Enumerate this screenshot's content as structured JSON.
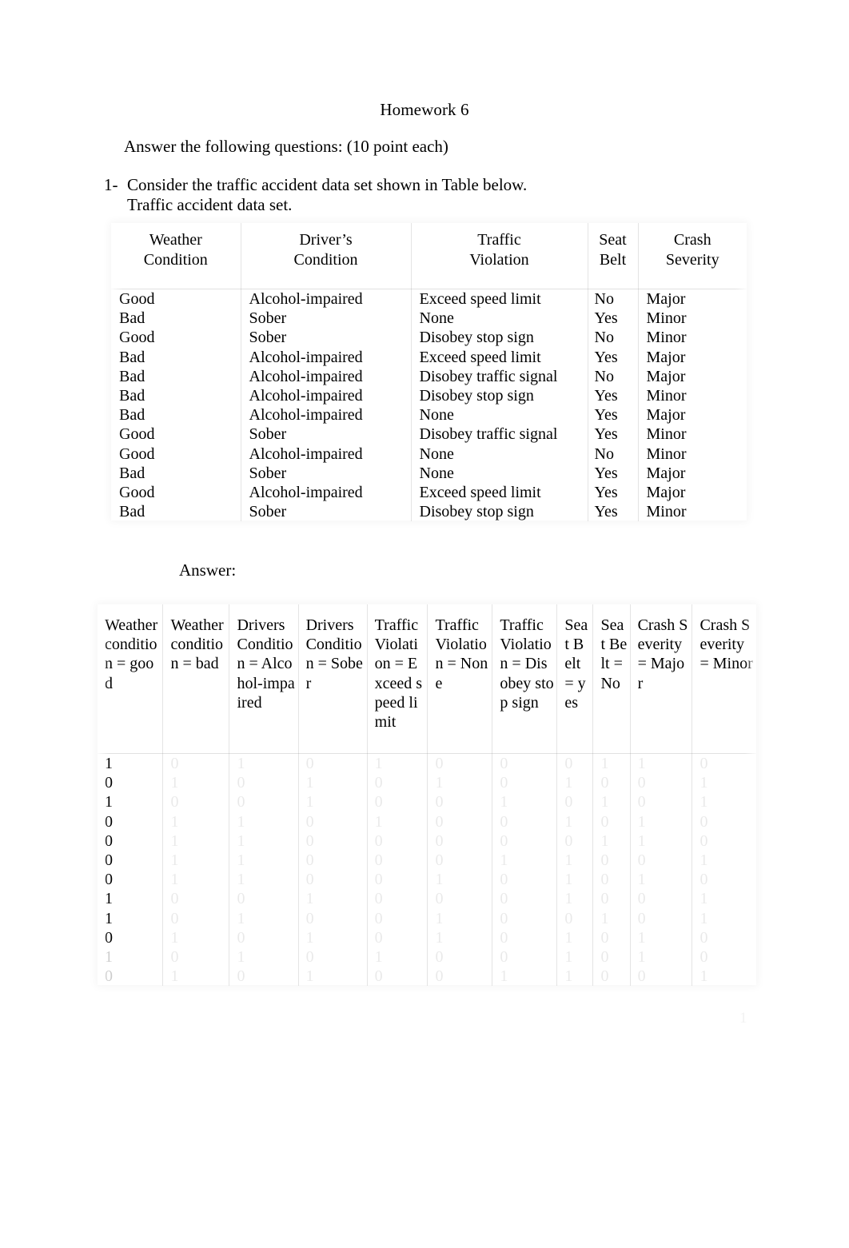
{
  "document": {
    "title": "Homework 6",
    "intro": "Answer the following questions: (10 point each)",
    "question_number": "1-",
    "question_text": "Consider the traffic accident data set shown in Table below.",
    "table_caption": "Traffic accident data set.",
    "answer_label": "Answer:",
    "page_number": "1"
  },
  "accident_table": {
    "headers": [
      "Weather Condition",
      "Driver’s Condition",
      "Traffic Violation",
      "Seat Belt",
      "Crash Severity"
    ],
    "rows": [
      {
        "weather": "Good",
        "driver": "Alcohol-impaired",
        "violation": "Exceed speed limit",
        "belt": "No",
        "severity": "Major"
      },
      {
        "weather": "Bad",
        "driver": "Sober",
        "violation": "None",
        "belt": "Yes",
        "severity": "Minor"
      },
      {
        "weather": "Good",
        "driver": "Sober",
        "violation": "Disobey stop sign",
        "belt": "No",
        "severity": "Minor"
      },
      {
        "weather": "Bad",
        "driver": "Alcohol-impaired",
        "violation": "Exceed speed limit",
        "belt": "Yes",
        "severity": "Major"
      },
      {
        "weather": "Bad",
        "driver": "Alcohol-impaired",
        "violation": "Disobey traffic signal",
        "belt": "No",
        "severity": "Major"
      },
      {
        "weather": "Bad",
        "driver": "Alcohol-impaired",
        "violation": "Disobey stop sign",
        "belt": "Yes",
        "severity": "Minor"
      },
      {
        "weather": "Bad",
        "driver": "Alcohol-impaired",
        "violation": "None",
        "belt": "Yes",
        "severity": "Major"
      },
      {
        "weather": "Good",
        "driver": "Sober",
        "violation": "Disobey traffic signal",
        "belt": "Yes",
        "severity": "Minor"
      },
      {
        "weather": "Good",
        "driver": "Alcohol-impaired",
        "violation": "None",
        "belt": "No",
        "severity": "Minor"
      },
      {
        "weather": "Bad",
        "driver": "Sober",
        "violation": "None",
        "belt": "Yes",
        "severity": "Major"
      },
      {
        "weather": "Good",
        "driver": "Alcohol-impaired",
        "violation": "Exceed speed limit",
        "belt": "Yes",
        "severity": "Major"
      },
      {
        "weather": "Bad",
        "driver": "Sober",
        "violation": "Disobey stop sign",
        "belt": "Yes",
        "severity": "Minor"
      }
    ]
  },
  "binary_table": {
    "headers": [
      "Weather condition = good",
      "Weather condition = bad",
      "Drivers Condition = Alcohol-impaired",
      "Drivers Condition = Sober",
      "Traffic Violation = Exceed speed limit",
      "Traffic Violation = None",
      "Traffic Violation = Disobey stop sign",
      "Seat Belt = yes",
      "Seat Belt = No",
      "Crash Severity = Major",
      "Crash Severity = Minor"
    ],
    "rows": [
      [
        "1",
        "0",
        "1",
        "0",
        "1",
        "0",
        "0",
        "0",
        "1",
        "1",
        "0"
      ],
      [
        "0",
        "1",
        "0",
        "1",
        "0",
        "1",
        "0",
        "1",
        "0",
        "0",
        "1"
      ],
      [
        "1",
        "0",
        "0",
        "1",
        "0",
        "0",
        "1",
        "0",
        "1",
        "0",
        "1"
      ],
      [
        "0",
        "1",
        "1",
        "0",
        "1",
        "0",
        "0",
        "1",
        "0",
        "1",
        "0"
      ],
      [
        "0",
        "1",
        "1",
        "0",
        "0",
        "0",
        "0",
        "0",
        "1",
        "1",
        "0"
      ],
      [
        "0",
        "1",
        "1",
        "0",
        "0",
        "0",
        "1",
        "1",
        "0",
        "0",
        "1"
      ],
      [
        "0",
        "1",
        "1",
        "0",
        "0",
        "1",
        "0",
        "1",
        "0",
        "1",
        "0"
      ],
      [
        "1",
        "0",
        "0",
        "1",
        "0",
        "0",
        "0",
        "1",
        "0",
        "0",
        "1"
      ],
      [
        "1",
        "0",
        "1",
        "0",
        "0",
        "1",
        "0",
        "0",
        "1",
        "0",
        "1"
      ],
      [
        "0",
        "1",
        "0",
        "1",
        "0",
        "1",
        "0",
        "1",
        "0",
        "1",
        "0"
      ],
      [
        "1",
        "0",
        "1",
        "0",
        "1",
        "0",
        "0",
        "1",
        "0",
        "1",
        "0"
      ],
      [
        "0",
        "1",
        "0",
        "1",
        "0",
        "0",
        "1",
        "1",
        "0",
        "0",
        "1"
      ]
    ]
  }
}
